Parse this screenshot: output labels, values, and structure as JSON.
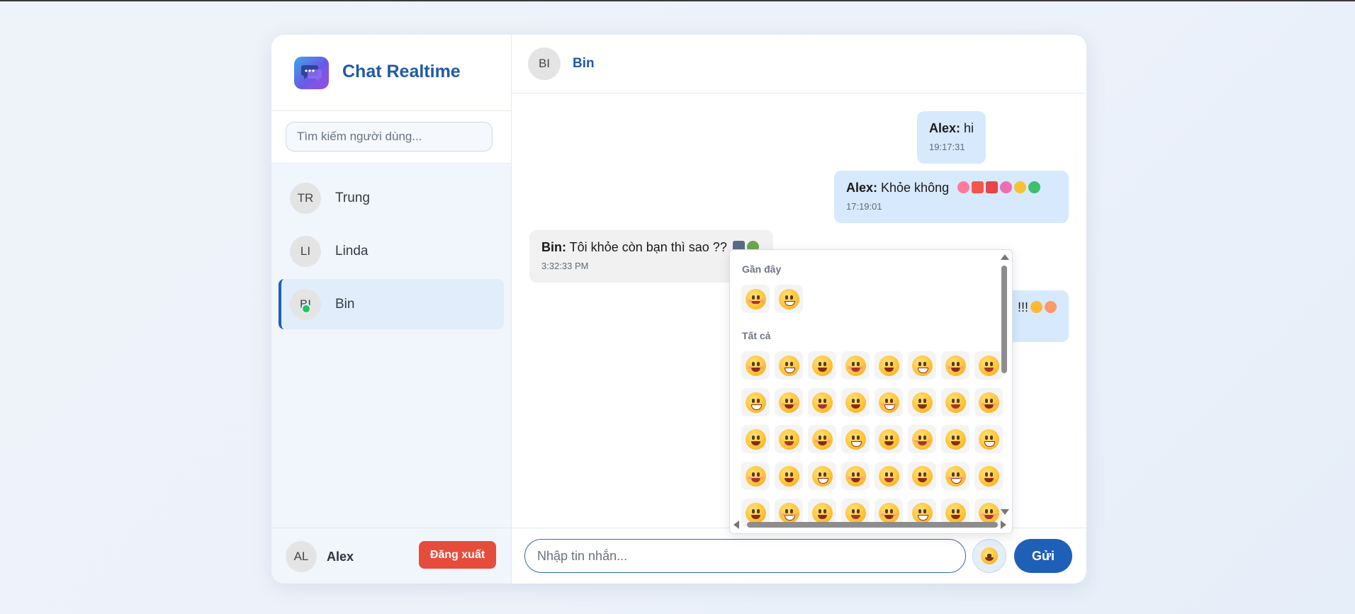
{
  "app": {
    "title": "Chat Realtime"
  },
  "search": {
    "placeholder": "Tìm kiếm người dùng..."
  },
  "users": [
    {
      "initials": "TR",
      "name": "Trung",
      "active": false,
      "online": false
    },
    {
      "initials": "LI",
      "name": "Linda",
      "active": false,
      "online": false
    },
    {
      "initials": "BI",
      "name": "Bin",
      "active": true,
      "online": true
    }
  ],
  "current_user": {
    "initials": "AL",
    "name": "Alex",
    "logout_label": "Đăng xuất"
  },
  "chat": {
    "initials": "BI",
    "name": "Bin"
  },
  "messages": [
    {
      "sender": "Alex:",
      "text": " hi",
      "time": "19:17:31",
      "mine": true
    },
    {
      "sender": "Alex:",
      "text": " Khỏe không",
      "emojis": [
        "heart-eyes",
        "gift",
        "hundred-points",
        "pink-heart",
        "yellow-heart",
        "green-heart"
      ],
      "time": "17:19:01",
      "mine": true
    },
    {
      "sender": "Bin:",
      "text": " Tôi khỏe còn bạn thì sao ??",
      "emojis": [
        "clapper-board",
        "alien"
      ],
      "time": "3:32:33 PM",
      "mine": false
    },
    {
      "text": "!!!",
      "emojis": [
        "grinning-squinting",
        "smiling-hearts"
      ],
      "mine": true
    }
  ],
  "input": {
    "placeholder": "Nhập tin nhắn...",
    "send_label": "Gửi",
    "emoji_button_icon": "smile-icon"
  },
  "emoji_picker": {
    "recent_label": "Gần đây",
    "all_label": "Tất cả",
    "recent": [
      "smiling-face-with-hearts",
      "beaming-face"
    ],
    "rows": 5,
    "cols": 8
  },
  "colors": {
    "primary": "#1e5fb8",
    "danger": "#e64c3c",
    "bubble_mine": "#d7e9fd",
    "bubble_theirs": "#f1f1f1",
    "online": "#22c55e"
  }
}
